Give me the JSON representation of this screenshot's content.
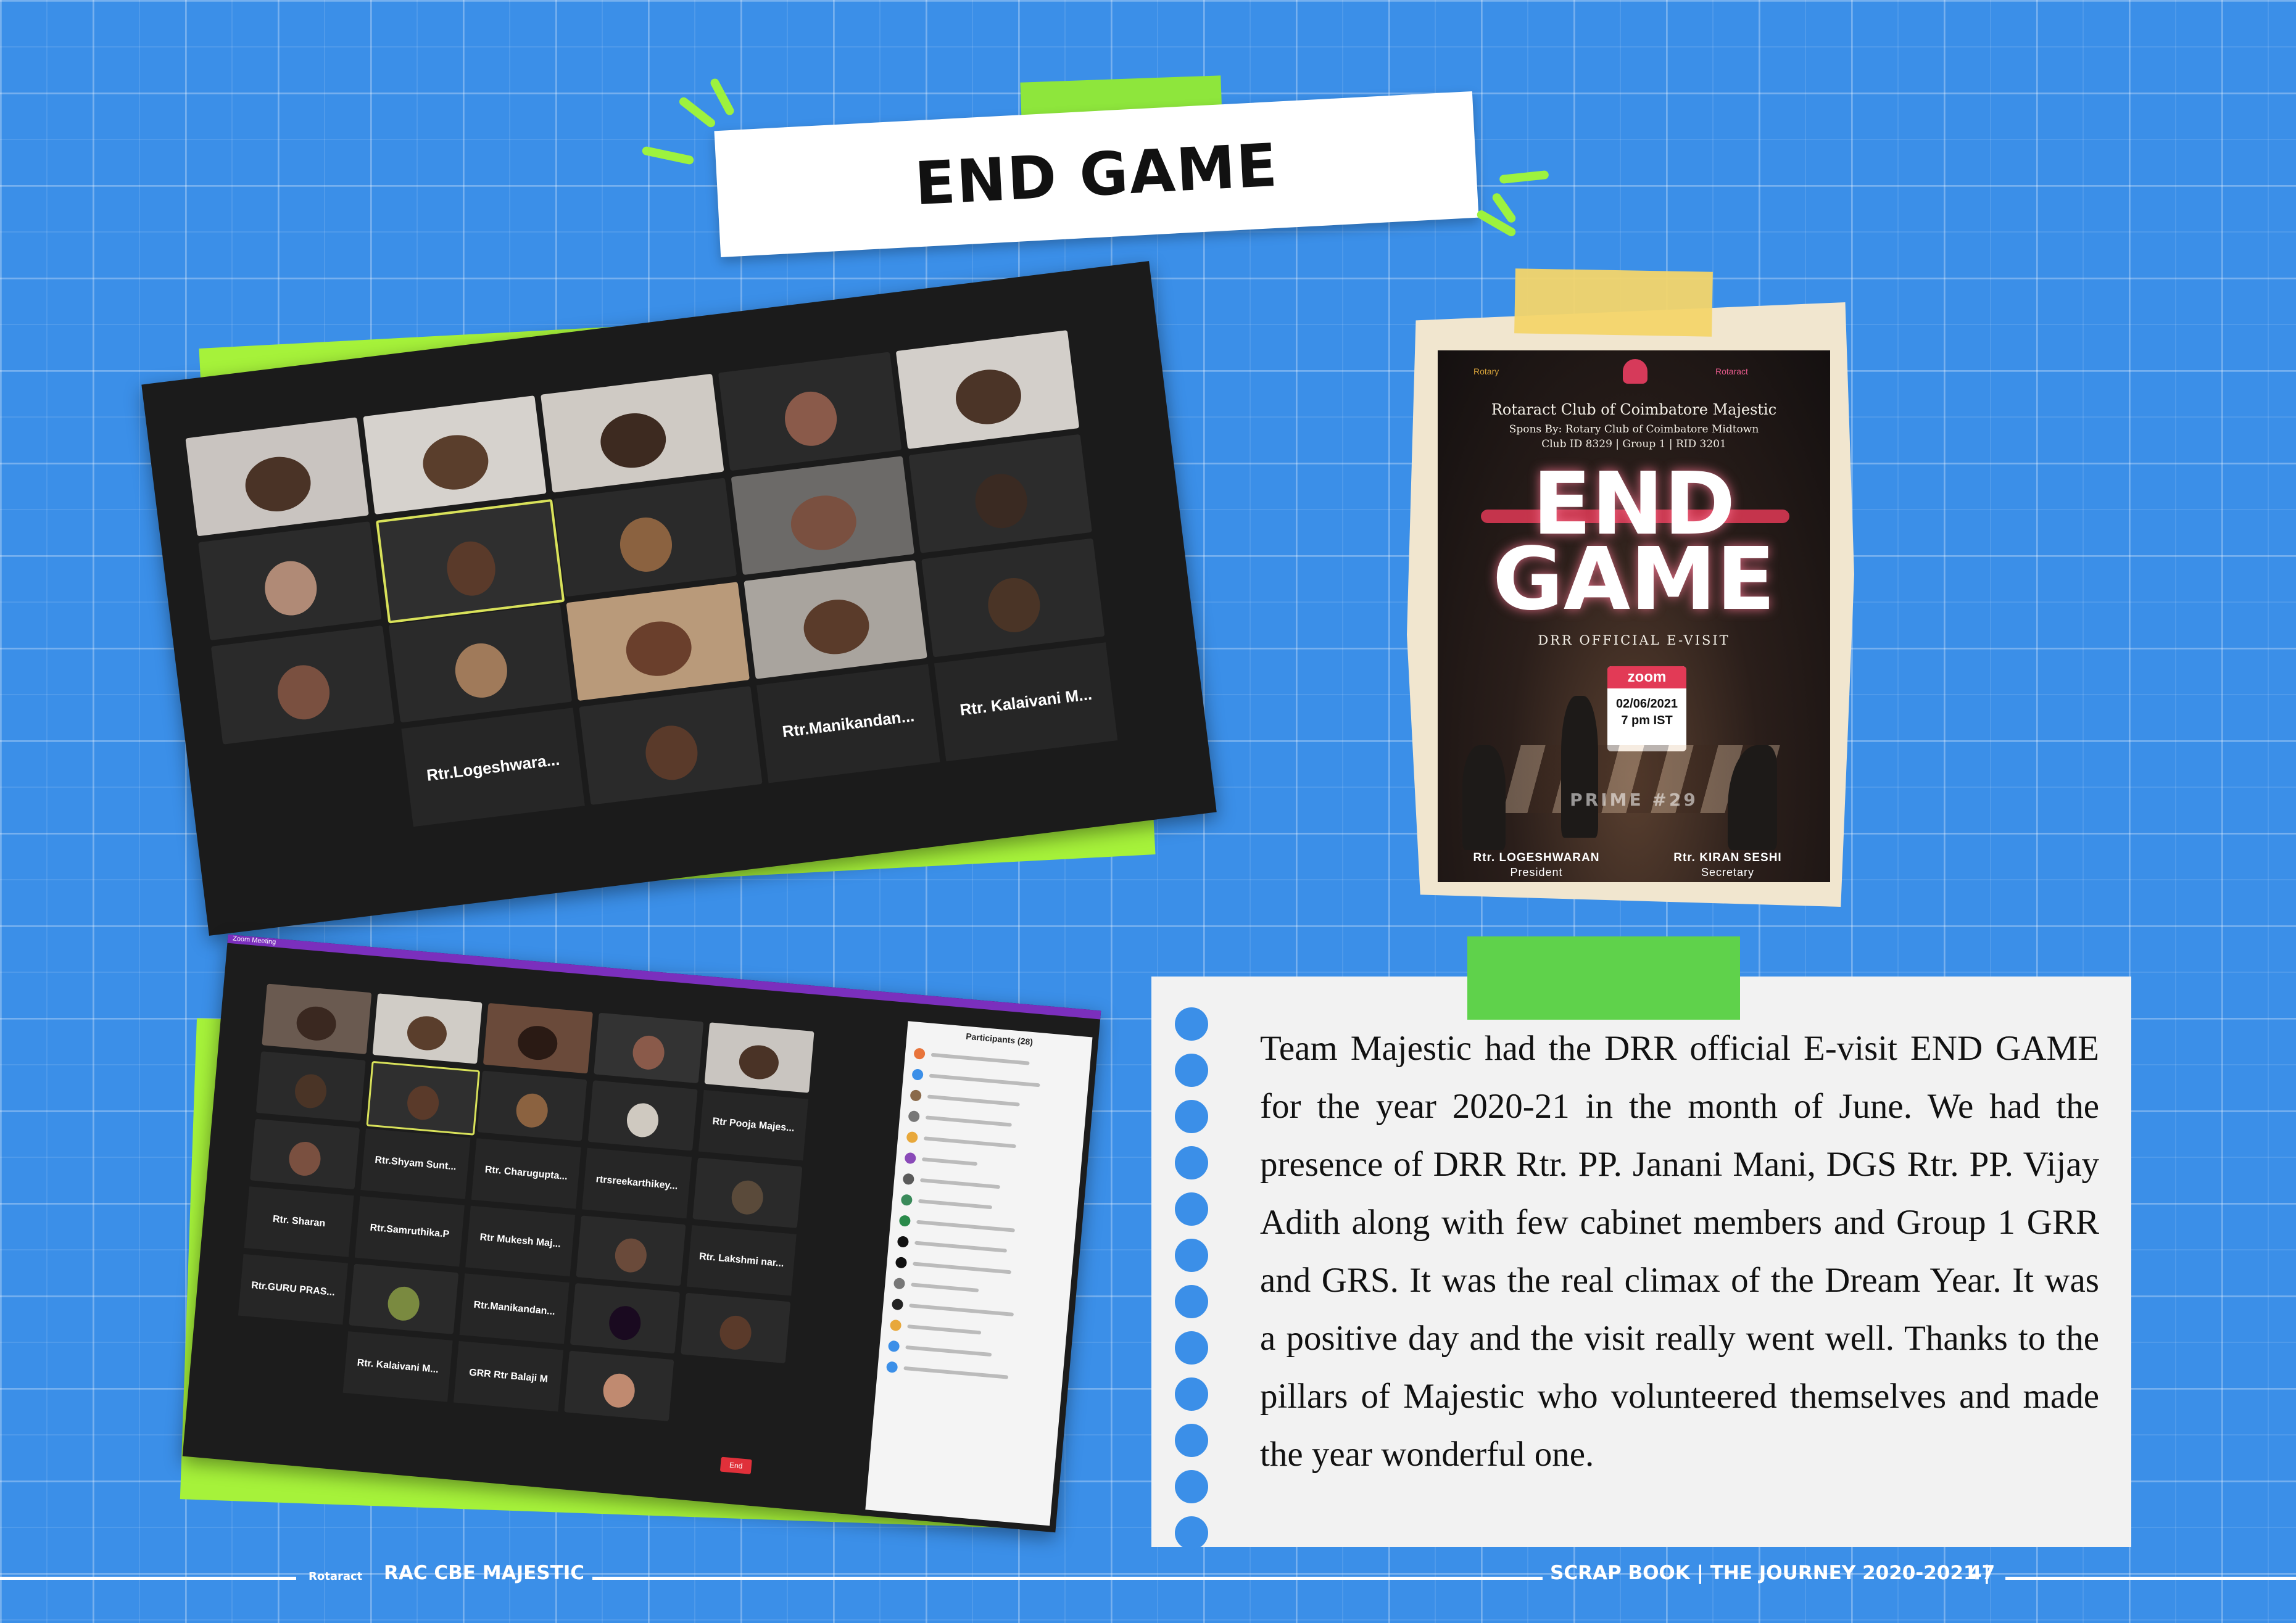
{
  "title": "END GAME",
  "poster": {
    "club_name": "Rotaract Club of Coimbatore Majestic",
    "sponsor": "Spons By: Rotary Club of Coimbatore Midtown",
    "club_id": "Club ID 8329 | Group 1 | RID 3201",
    "heading_line1": "END",
    "heading_line2": "GAME",
    "subtitle": "DRR OFFICIAL E-VISIT",
    "zoom_label": "zoom",
    "date": "02/06/2021",
    "time": "7 pm IST",
    "prime": "PRIME #29",
    "president_name": "Rtr. LOGESHWARAN",
    "president_title": "President",
    "secretary_name": "Rtr. KIRAN SESHI",
    "secretary_title": "Secretary",
    "logo_left": "Rotary",
    "logo_right": "Rotaract"
  },
  "zoom_call_1": {
    "name_tiles": [
      "Rtr.Logeshwara...",
      "Rtr.Manikandan...",
      "Rtr. Kalaivani M..."
    ]
  },
  "zoom_call_2": {
    "window_title": "Zoom Meeting",
    "participants_header": "Participants (28)",
    "name_tiles": [
      "Rtr.Shyam Sunt...",
      "Rtr. Charugupta...",
      "rtrsreekarthikey...",
      "Rtr Pooja Majes...",
      "Rtr. Sharan",
      "Rtr.Samruthika.P",
      "Rtr Mukesh Maj...",
      "Rtr. Lakshmi nar...",
      "Rtr.GURU PRAS...",
      "Rtr.Manikandan...",
      "Rtr. Kalaivani M...",
      "GRR Rtr Balaji M"
    ],
    "end_button": "End"
  },
  "body_text": "Team Majestic had the DRR official E-visit END GAME for the year 2020-21 in the month of June. We had the presence of DRR Rtr. PP. Janani Mani, DGS Rtr. PP. Vijay Adith along with few cabinet members and Group 1 GRR and GRS. It was the real climax of the Dream Year. It was a positive day and the visit really went well. Thanks to the pillars of Majestic who volunteered themselves and made the year wonderful one.",
  "footer": {
    "left": "RAC CBE MAJESTIC",
    "left_logo": "Rotaract",
    "right": "SCRAP BOOK | THE JOURNEY 2020-2021 |",
    "page_number": "47"
  }
}
